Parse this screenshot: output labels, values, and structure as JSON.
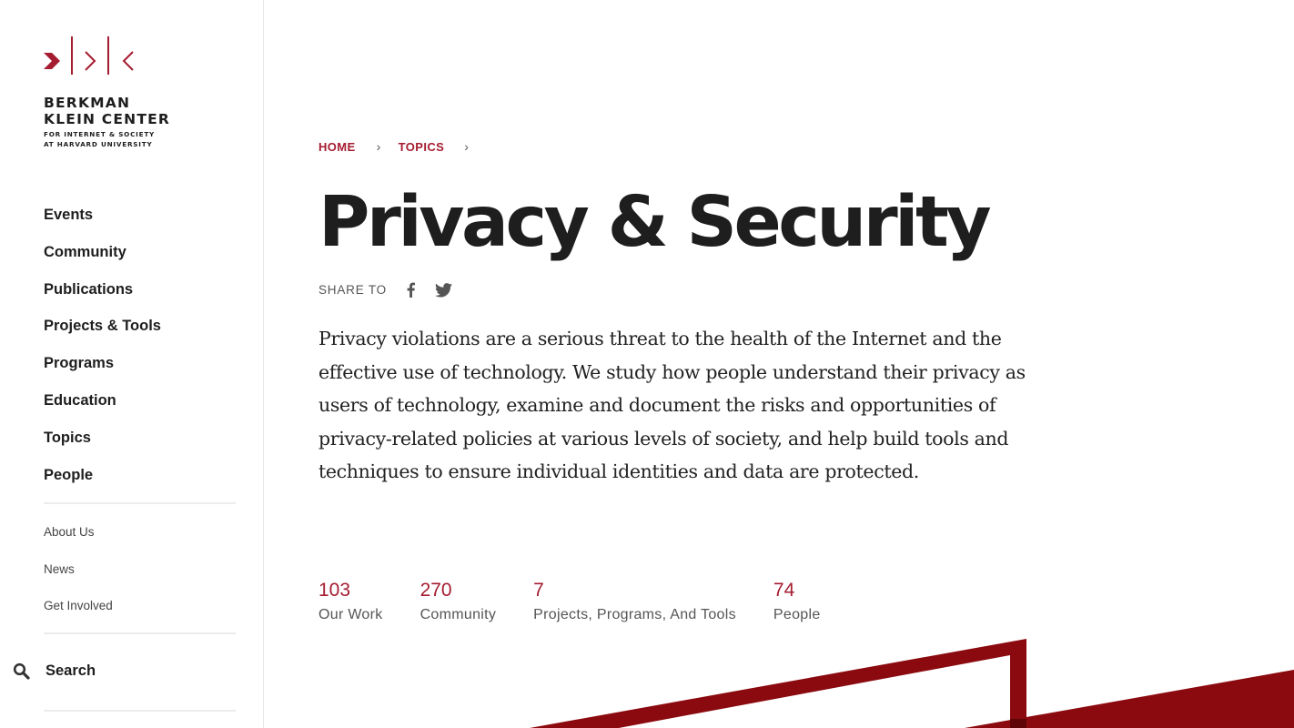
{
  "logo": {
    "line1": "BERKMAN",
    "line2": "KLEIN CENTER",
    "sub1": "FOR INTERNET & SOCIETY",
    "sub2": "AT HARVARD UNIVERSITY",
    "accent_color": "#a51c30"
  },
  "sidebar": {
    "main_items": [
      {
        "label": "Events"
      },
      {
        "label": "Community"
      },
      {
        "label": "Publications"
      },
      {
        "label": "Projects & Tools"
      },
      {
        "label": "Programs"
      },
      {
        "label": "Education"
      },
      {
        "label": "Topics"
      },
      {
        "label": "People"
      }
    ],
    "secondary_items": [
      {
        "label": "About Us"
      },
      {
        "label": "News"
      },
      {
        "label": "Get Involved"
      }
    ],
    "search_label": "Search",
    "search_icon": "search-icon"
  },
  "breadcrumb": {
    "items": [
      {
        "label": "HOME"
      },
      {
        "label": "TOPICS"
      }
    ],
    "separator": "›"
  },
  "page": {
    "title": "Privacy & Security",
    "share_label": "SHARE TO",
    "share_icons": [
      "facebook-icon",
      "twitter-icon"
    ],
    "description": "Privacy violations are a serious threat to the health of the Internet and the effective use of technology. We study how people understand their privacy as users of technology, examine and document the risks and opportunities of privacy-related policies at various levels of society, and help build tools and techniques to ensure individual identities and data are protected."
  },
  "stats": [
    {
      "count": "103",
      "label": "Our Work"
    },
    {
      "count": "270",
      "label": "Community"
    },
    {
      "count": "7",
      "label": "Projects, Programs, And Tools"
    },
    {
      "count": "74",
      "label": "People"
    }
  ],
  "colors": {
    "accent": "#a51c30",
    "decoration": "#8b0a0f",
    "text": "#1e1e1e"
  }
}
